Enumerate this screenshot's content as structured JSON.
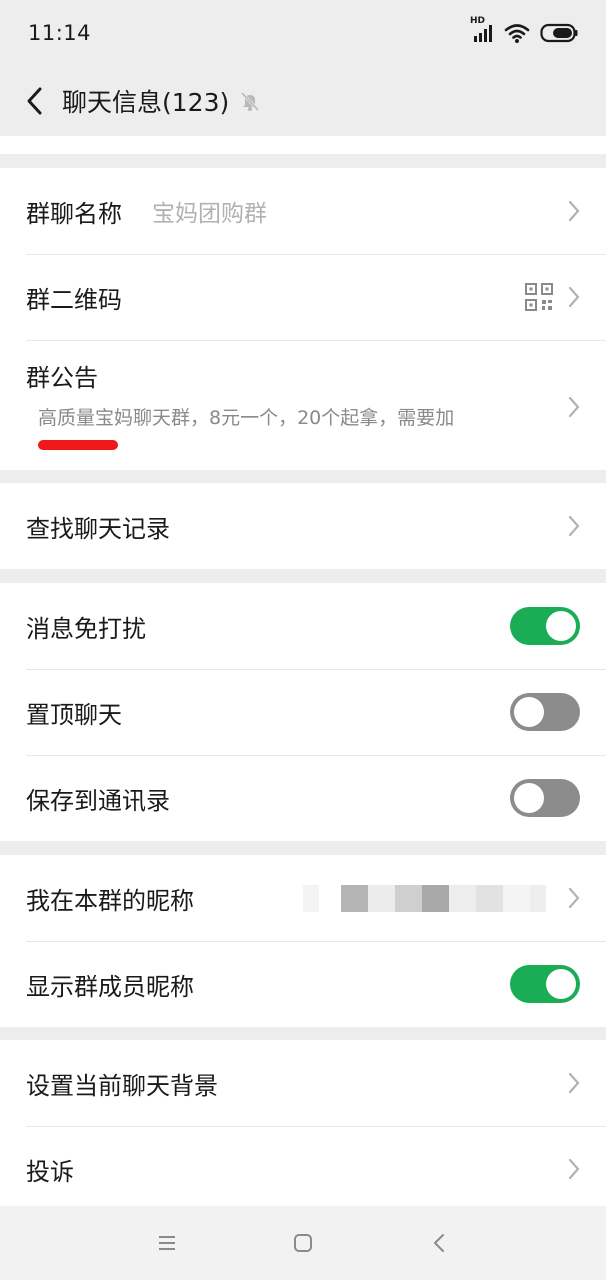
{
  "status_bar": {
    "time": "11:14",
    "hd_label": "HD"
  },
  "nav": {
    "title": "聊天信息(123)",
    "back_icon": "chevron-left-icon",
    "mute_icon": "bell-off-icon"
  },
  "group1": {
    "group_name_label": "群聊名称",
    "group_name_value": "宝妈团购群",
    "qr_label": "群二维码",
    "notice_label": "群公告",
    "notice_text": "高质量宝妈聊天群，8元一个，20个起拿，需要加"
  },
  "group2": {
    "search_label": "查找聊天记录"
  },
  "group3": {
    "mute_label": "消息免打扰",
    "mute_on": true,
    "pin_label": "置顶聊天",
    "pin_on": false,
    "save_label": "保存到通讯录",
    "save_on": false
  },
  "group4": {
    "nickname_label": "我在本群的昵称",
    "show_nickname_label": "显示群成员昵称",
    "show_nickname_on": true
  },
  "group5": {
    "background_label": "设置当前聊天背景",
    "report_label": "投诉"
  },
  "colors": {
    "toggle_on": "#1aad55",
    "toggle_off": "#8c8c8c",
    "page_bg": "#ededed",
    "redaction": "#f01818"
  }
}
